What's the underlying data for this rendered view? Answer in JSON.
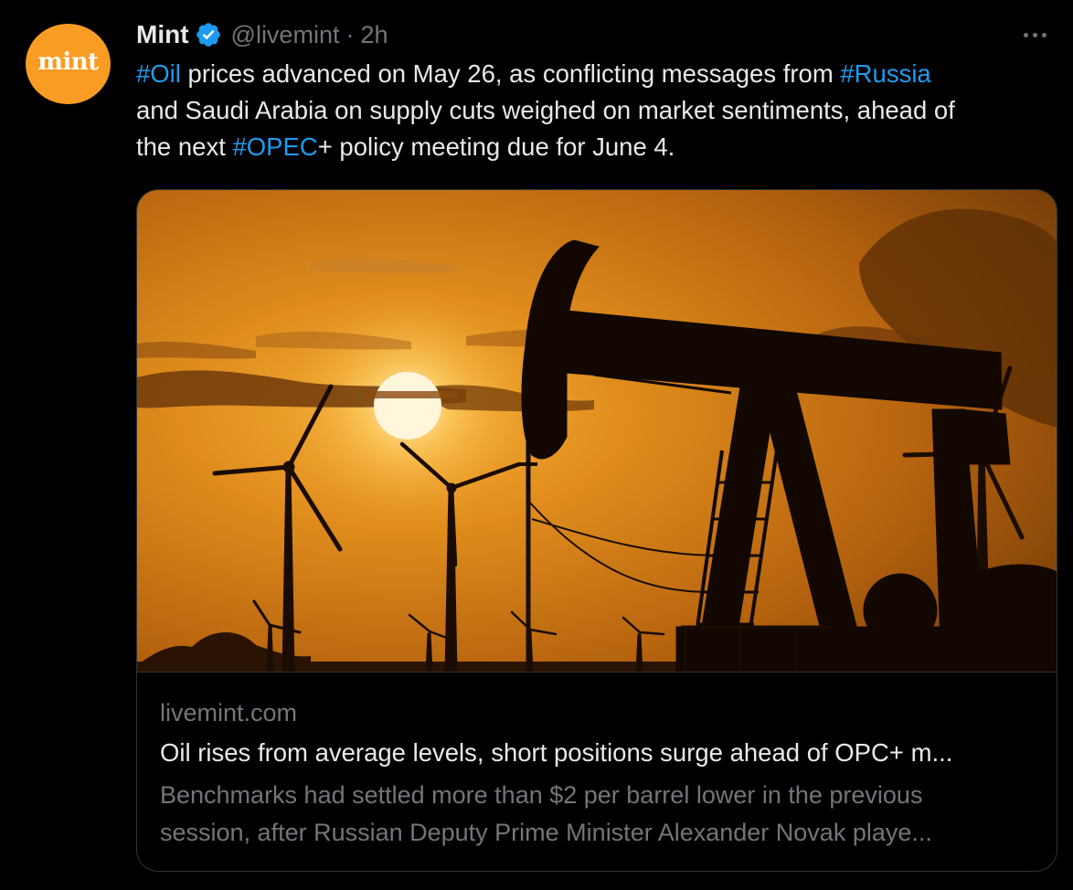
{
  "author": {
    "avatar_text": "mint",
    "display_name": "Mint",
    "handle": "@livemint",
    "separator": "·",
    "time": "2h",
    "verified_icon": "verified-badge-icon"
  },
  "tweet": {
    "lines": [
      [
        {
          "text": "#Oil",
          "hashtag": true
        },
        {
          "text": " prices advanced on May 26, as conflicting messages from ",
          "hashtag": false
        },
        {
          "text": "#Russia",
          "hashtag": true
        }
      ],
      [
        {
          "text": "and Saudi Arabia on supply cuts weighed on market sentiments, ahead of",
          "hashtag": false
        }
      ],
      [
        {
          "text": "the next ",
          "hashtag": false
        },
        {
          "text": "#OPEC",
          "hashtag": true
        },
        {
          "text": "+ policy meeting due for June 4.",
          "hashtag": false
        }
      ]
    ]
  },
  "card": {
    "image_icon": "oil-pumpjack-sunset-photo",
    "domain": "livemint.com",
    "title": "Oil rises from average levels, short positions surge ahead of OPC+ m...",
    "description_lines": [
      "Benchmarks had settled more than $2 per barrel lower in the previous",
      "session, after Russian Deputy Prime Minister Alexander Novak playe..."
    ]
  },
  "colors": {
    "background": "#000000",
    "text": "#e7e9ea",
    "muted": "#71767b",
    "link": "#1d9bf0",
    "avatar": "#f99c24",
    "border": "#2f3336"
  }
}
